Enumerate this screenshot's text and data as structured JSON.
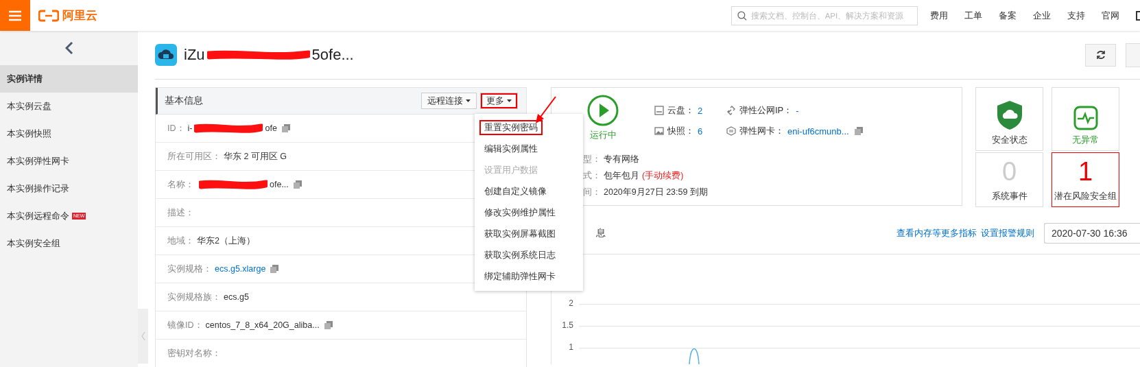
{
  "topbar": {
    "logo_text": "阿里云",
    "search": {
      "placeholder": "搜索文档、控制台、API、解决方案和资源"
    },
    "nav": [
      "费用",
      "工单",
      "备案",
      "企业",
      "支持",
      "官网"
    ]
  },
  "sidebar": {
    "items": [
      {
        "label": "实例详情",
        "selected": true
      },
      {
        "label": "本实例云盘",
        "selected": false
      },
      {
        "label": "本实例快照",
        "selected": false
      },
      {
        "label": "本实例弹性网卡",
        "selected": false
      },
      {
        "label": "本实例操作记录",
        "selected": false
      },
      {
        "label": "本实例远程命令",
        "selected": false,
        "badge": "NEW"
      },
      {
        "label": "本实例安全组",
        "selected": false
      }
    ]
  },
  "instance": {
    "title_start": "iZu",
    "title_end": "5ofe...",
    "redacted": true
  },
  "basic_info": {
    "title": "基本信息",
    "buttons": [
      {
        "label": "远程连接",
        "highlighted": false
      },
      {
        "label": "更多",
        "highlighted": true
      }
    ],
    "rows": [
      {
        "label": "ID：",
        "value": "i-",
        "value_end": "ofe",
        "redacted": true,
        "link": false,
        "copyable": true
      },
      {
        "label": "所在可用区：",
        "value": "华东 2 可用区 G",
        "redacted": false,
        "link": false,
        "copyable": false
      },
      {
        "label": "名称：",
        "value": "",
        "value_end": "ofe...",
        "redacted": true,
        "link": false,
        "copyable": true
      },
      {
        "label": "描述：",
        "redacted": false,
        "copyable": false
      },
      {
        "label": "地域：",
        "value": "华东2（上海）",
        "redacted": false,
        "link": false,
        "copyable": false
      },
      {
        "label": "实例规格：",
        "value": "ecs.g5.xlarge",
        "redacted": false,
        "link": true,
        "copyable": true
      },
      {
        "label": "实例规格族：",
        "value": "ecs.g5",
        "redacted": false,
        "link": false,
        "copyable": false
      },
      {
        "label": "镜像ID：",
        "value": "centos_7_8_x64_20G_aliba...",
        "redacted": false,
        "link": false,
        "copyable": true
      },
      {
        "label": "密钥对名称：",
        "redacted": false,
        "copyable": false
      }
    ]
  },
  "more_menu": {
    "items": [
      {
        "label": "重置实例密码",
        "disabled": false,
        "highlighted": true
      },
      {
        "label": "编辑实例属性",
        "disabled": false,
        "highlighted": false
      },
      {
        "label": "设置用户数据",
        "disabled": true,
        "highlighted": false
      },
      {
        "label": "创建自定义镜像",
        "disabled": false,
        "highlighted": false
      },
      {
        "label": "修改实例维护属性",
        "disabled": false,
        "highlighted": false
      },
      {
        "label": "获取实例屏幕截图",
        "disabled": false,
        "highlighted": false
      },
      {
        "label": "获取实例系统日志",
        "disabled": false,
        "highlighted": false
      },
      {
        "label": "绑定辅助弹性网卡",
        "disabled": false,
        "highlighted": false
      }
    ]
  },
  "status": {
    "state": "运行中",
    "stats": [
      {
        "kind": "disk",
        "label": "云盘：",
        "value": "2"
      },
      {
        "kind": "snapshot",
        "label": "快照：",
        "value": "6"
      },
      {
        "kind": "eip",
        "label": "弹性公网IP：",
        "value": "-"
      },
      {
        "kind": "eni",
        "label": "弹性网卡：",
        "value": "eni-uf6cmunb..."
      }
    ],
    "details": [
      {
        "label": "型：",
        "value": "专有网络"
      },
      {
        "label": "式：",
        "value": "包年包月",
        "note": "(手动续费)"
      },
      {
        "label": "间：",
        "value": "2020年9月27日 23:59 到期"
      }
    ]
  },
  "tiles": [
    {
      "kind": "shield",
      "label": "安全状态",
      "alert": false
    },
    {
      "kind": "pulse",
      "label": "无异常",
      "alert": false
    },
    {
      "kind": "count",
      "value": "0",
      "label": "系统事件",
      "alert": false
    },
    {
      "kind": "count",
      "value": "1",
      "label": "潜在风险安全组",
      "alert": true
    }
  ],
  "monitor": {
    "title": "息",
    "links": [
      "查看内存等更多指标",
      "设置报警规则"
    ],
    "date": "2020-07-30 16:36",
    "y_ticks": [
      "2",
      "1.5",
      "1"
    ]
  }
}
